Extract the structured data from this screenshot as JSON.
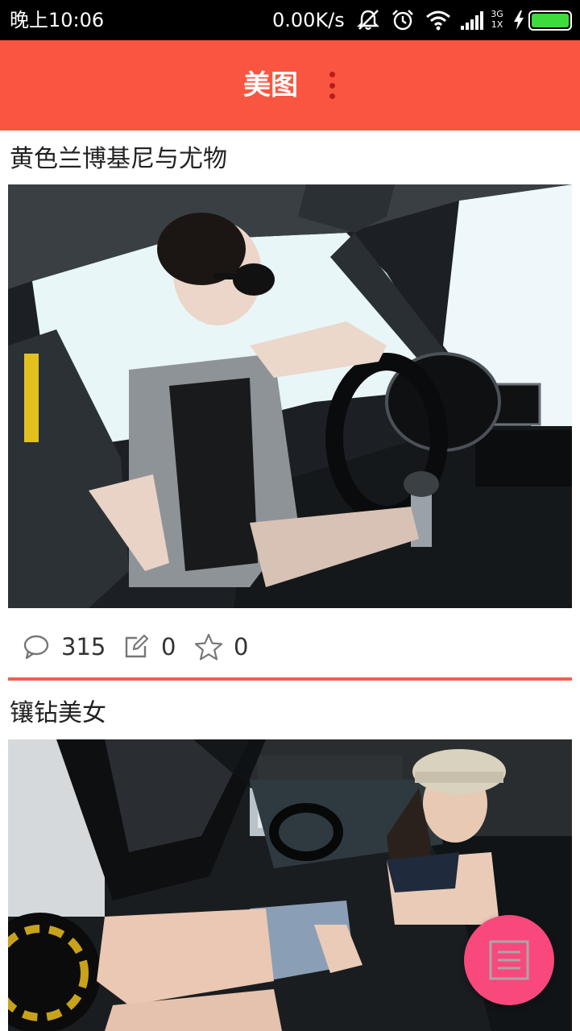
{
  "status_bar": {
    "time": "晚上10:06",
    "net_speed": "0.00K/s",
    "network_type": "3G",
    "sim_slot": "1X",
    "icons": [
      "mute-icon",
      "alarm-icon",
      "wifi-icon",
      "signal-icon",
      "charging-icon",
      "battery-icon"
    ],
    "battery_level": 1.0
  },
  "app_bar": {
    "title": "美图",
    "more_icon": "more-vert-icon"
  },
  "colors": {
    "accent": "#fa5540",
    "divider": "#f0614c",
    "fab": "#f8487c",
    "battery": "#3ddc3a"
  },
  "posts": [
    {
      "title": "黄色兰博基尼与尤物",
      "comments": "315",
      "edits": "0",
      "favorites": "0",
      "icons": [
        "comment-icon",
        "edit-icon",
        "star-icon"
      ]
    },
    {
      "title": "镶钻美女"
    }
  ],
  "fab": {
    "icon": "document-list-icon"
  }
}
